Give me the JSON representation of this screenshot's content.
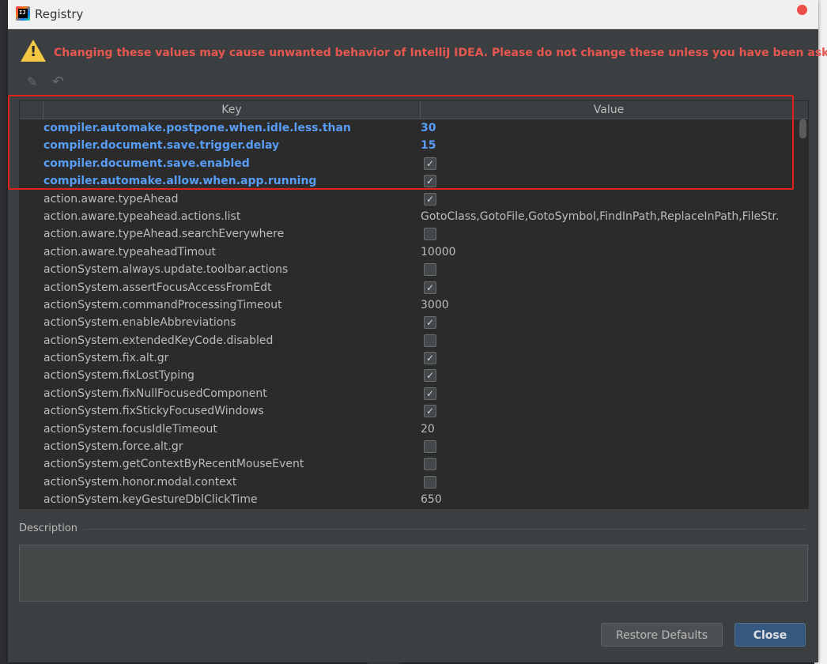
{
  "window": {
    "title": "Registry"
  },
  "warning": {
    "text": "Changing these values may cause unwanted behavior of IntelliJ IDEA. Please do not change these unless you have been asked."
  },
  "toolbar": {
    "edit_icon": "pencil-icon",
    "undo_icon": "undo-icon"
  },
  "table": {
    "columns": [
      "Key",
      "Value"
    ],
    "rows": [
      {
        "key": "compiler.automake.postpone.when.idle.less.than",
        "value": "30",
        "modified": true
      },
      {
        "key": "compiler.document.save.trigger.delay",
        "value": "15",
        "modified": true
      },
      {
        "key": "compiler.document.save.enabled",
        "checkbox": true,
        "modified": true
      },
      {
        "key": "compiler.automake.allow.when.app.running",
        "checkbox": true,
        "modified": true
      },
      {
        "key": "action.aware.typeAhead",
        "checkbox": true
      },
      {
        "key": "action.aware.typeahead.actions.list",
        "value": "GotoClass,GotoFile,GotoSymbol,FindInPath,ReplaceInPath,FileStr."
      },
      {
        "key": "action.aware.typeAhead.searchEverywhere",
        "checkbox": false
      },
      {
        "key": "action.aware.typeaheadTimout",
        "value": "10000"
      },
      {
        "key": "actionSystem.always.update.toolbar.actions",
        "checkbox": false
      },
      {
        "key": "actionSystem.assertFocusAccessFromEdt",
        "checkbox": true
      },
      {
        "key": "actionSystem.commandProcessingTimeout",
        "value": "3000"
      },
      {
        "key": "actionSystem.enableAbbreviations",
        "checkbox": true
      },
      {
        "key": "actionSystem.extendedKeyCode.disabled",
        "checkbox": false
      },
      {
        "key": "actionSystem.fix.alt.gr",
        "checkbox": true
      },
      {
        "key": "actionSystem.fixLostTyping",
        "checkbox": true
      },
      {
        "key": "actionSystem.fixNullFocusedComponent",
        "checkbox": true
      },
      {
        "key": "actionSystem.fixStickyFocusedWindows",
        "checkbox": true
      },
      {
        "key": "actionSystem.focusIdleTimeout",
        "value": "20"
      },
      {
        "key": "actionSystem.force.alt.gr",
        "checkbox": false
      },
      {
        "key": "actionSystem.getContextByRecentMouseEvent",
        "checkbox": false
      },
      {
        "key": "actionSystem.honor.modal.context",
        "checkbox": false
      },
      {
        "key": "actionSystem.keyGestureDblClickTime",
        "value": "650"
      }
    ]
  },
  "description": {
    "label": "Description",
    "text": ""
  },
  "buttons": {
    "restore_defaults": "Restore Defaults",
    "close": "Close"
  },
  "colors": {
    "modified_text": "#589df6",
    "warning_text": "#e8574f",
    "highlight_border": "#e0231c",
    "primary_button": "#365880"
  }
}
